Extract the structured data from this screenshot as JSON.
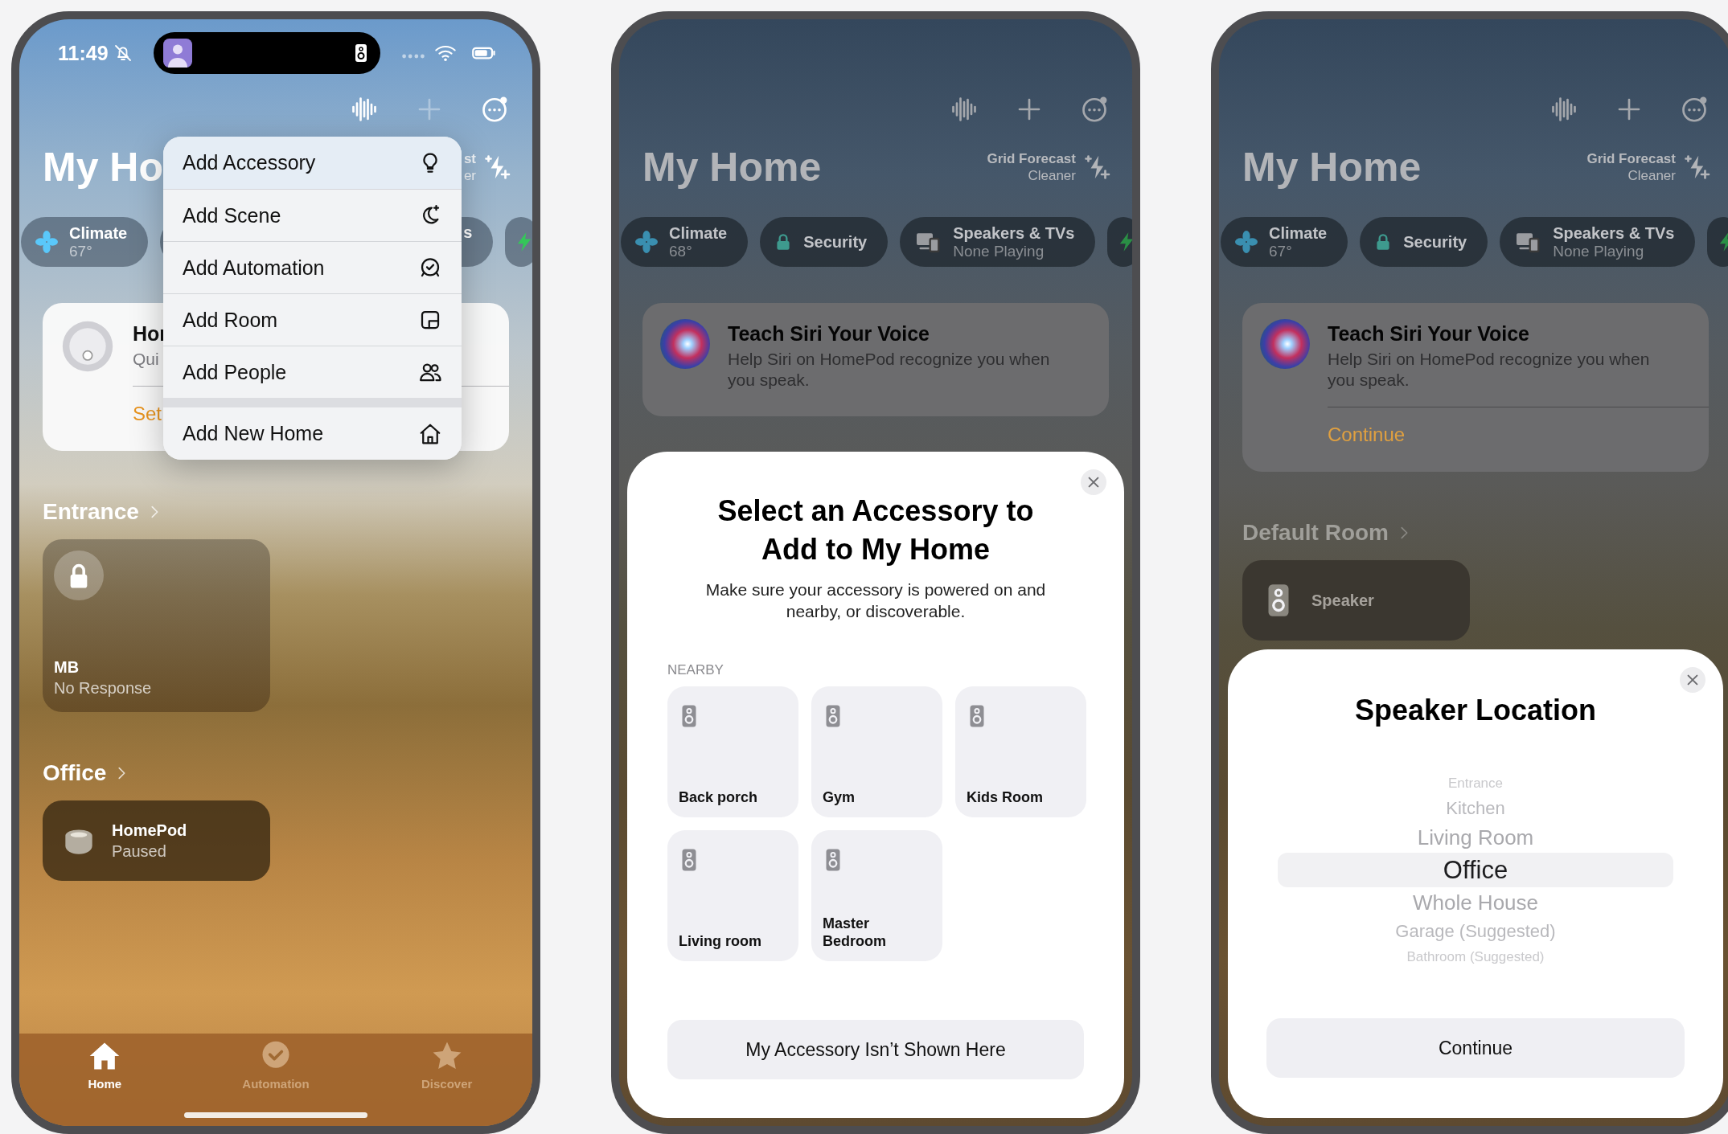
{
  "phones": [
    {
      "kind": "home-menu",
      "status_bar": {
        "time": "11:49"
      },
      "title": "My Ho",
      "forecast": [
        "st",
        "er"
      ],
      "chips": [
        {
          "kind": "climate",
          "label": "Climate",
          "value": "67°"
        },
        {
          "kind": "plain",
          "label": "s"
        },
        {
          "kind": "energy"
        }
      ],
      "card": {
        "kind": "hub",
        "title": "Hor",
        "text": "Qui",
        "action": "Set"
      },
      "rooms": [
        {
          "name": "Entrance",
          "tiles": [
            {
              "kind": "lock",
              "name": "MB",
              "status": "No Response"
            }
          ]
        },
        {
          "name": "Office",
          "tiles": [
            {
              "kind": "homepod",
              "name": "HomePod",
              "status": "Paused"
            }
          ]
        }
      ],
      "menu": [
        {
          "kind": "accessory",
          "label": "Add Accessory",
          "separated": false
        },
        {
          "kind": "scene",
          "label": "Add Scene",
          "separated": false
        },
        {
          "kind": "automation",
          "label": "Add Automation",
          "separated": false
        },
        {
          "kind": "room",
          "label": "Add Room",
          "separated": false
        },
        {
          "kind": "people",
          "label": "Add People",
          "separated": false
        },
        {
          "kind": "home",
          "label": "Add New Home",
          "separated": true
        }
      ],
      "tab_bar": [
        {
          "kind": "home",
          "label": "Home",
          "selected": true
        },
        {
          "kind": "automation",
          "label": "Automation",
          "selected": false
        },
        {
          "kind": "discover",
          "label": "Discover",
          "selected": false
        }
      ]
    },
    {
      "kind": "accessory-sheet",
      "title": "My Home",
      "forecast": [
        "Grid Forecast",
        "Cleaner"
      ],
      "chips": [
        {
          "kind": "climate",
          "label": "Climate",
          "value": "68°"
        },
        {
          "kind": "security",
          "label": "Security"
        },
        {
          "kind": "media",
          "label": "Speakers & TVs",
          "value": "None Playing"
        },
        {
          "kind": "energy"
        }
      ],
      "card": {
        "kind": "siri",
        "title": "Teach Siri Your Voice",
        "text": "Help Siri on HomePod recognize you when you speak."
      },
      "sheet": {
        "kind": "accessories",
        "title": "Select an Accessory to Add to My Home",
        "subtitle": "Make sure your accessory is powered on and nearby, or discoverable.",
        "section": "NEARBY",
        "tiles": [
          "Back porch",
          "Gym",
          "Kids Room",
          "Living room",
          "Master Bedroom"
        ],
        "button": "My Accessory Isn’t Shown Here"
      }
    },
    {
      "kind": "location-sheet",
      "title": "My Home",
      "forecast": [
        "Grid Forecast",
        "Cleaner"
      ],
      "chips": [
        {
          "kind": "climate",
          "label": "Climate",
          "value": "67°"
        },
        {
          "kind": "security",
          "label": "Security"
        },
        {
          "kind": "media",
          "label": "Speakers & TVs",
          "value": "None Playing"
        },
        {
          "kind": "energy"
        }
      ],
      "card": {
        "kind": "siri",
        "title": "Teach Siri Your Voice",
        "text": "Help Siri on HomePod recognize you when you speak.",
        "action": "Continue"
      },
      "rooms": [
        {
          "name": "Default Room",
          "tiles": [
            {
              "kind": "speaker",
              "name": "Speaker"
            }
          ]
        }
      ],
      "sheet": {
        "kind": "location",
        "title": "Speaker Location",
        "options": [
          {
            "label": "Entrance",
            "selected": false
          },
          {
            "label": "Kitchen",
            "selected": false
          },
          {
            "label": "Living Room",
            "selected": false
          },
          {
            "label": "Office",
            "selected": true
          },
          {
            "label": "Whole House",
            "selected": false
          },
          {
            "label": "Garage (Suggested)",
            "selected": false
          },
          {
            "label": "Bathroom (Suggested)",
            "selected": false
          }
        ],
        "button": "Continue"
      }
    }
  ]
}
